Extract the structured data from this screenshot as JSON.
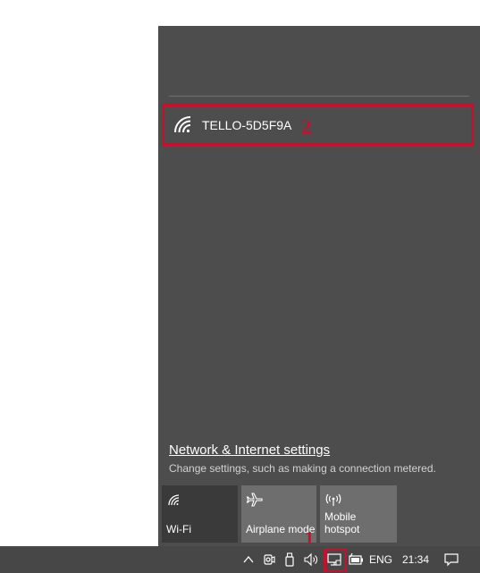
{
  "network": {
    "ssid": "TELLO-5D5F9A"
  },
  "settings": {
    "link_label": "Network & Internet settings",
    "description": "Change settings, such as making a connection metered."
  },
  "quick_actions": [
    {
      "label": "Wi-Fi",
      "icon": "wifi-icon",
      "state": "off"
    },
    {
      "label": "Airplane mode",
      "icon": "airplane-icon",
      "state": "available"
    },
    {
      "label_lines": [
        "Mobile",
        "hotspot"
      ],
      "icon": "hotspot-icon",
      "state": "available"
    }
  ],
  "taskbar": {
    "language": "ENG",
    "time": "21:34",
    "icons": [
      "chevron-up-icon",
      "camera-icon",
      "usb-icon",
      "speaker-icon",
      "network-icon",
      "battery-icon",
      "notification-icon"
    ]
  },
  "annotations": {
    "first": "1",
    "second": "2",
    "color": "#c8102e"
  },
  "colors": {
    "flyout_bg": "#4d4d4d",
    "taskbar_bg": "#474747",
    "tile_active": "#6e6e6e",
    "tile_inactive": "#3a3a3a"
  }
}
